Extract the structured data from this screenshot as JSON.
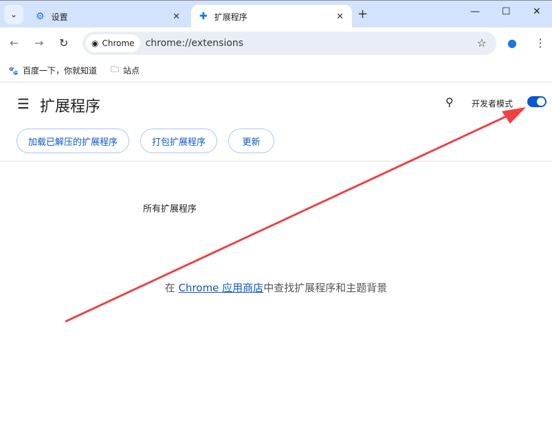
{
  "tabs": [
    {
      "label": "设置",
      "icon": "gear-icon"
    },
    {
      "label": "扩展程序",
      "icon": "puzzle-icon"
    }
  ],
  "omnibox": {
    "chip": "Chrome",
    "url": "chrome://extensions"
  },
  "bookmarks": [
    {
      "label": "百度一下，你就知道",
      "icon": "baidu-icon"
    },
    {
      "label": "站点",
      "icon": "folder-icon"
    }
  ],
  "header": {
    "title": "扩展程序",
    "dev_mode_label": "开发者模式",
    "dev_mode_on": true
  },
  "buttons": {
    "load": "加载已解压的扩展程序",
    "pack": "打包扩展程序",
    "update": "更新"
  },
  "main": {
    "section": "所有扩展程序",
    "store_prefix": "在 ",
    "store_link": "Chrome 应用商店",
    "store_suffix": "中查找扩展程序和主题背景"
  },
  "colors": {
    "accent": "#0b57d0",
    "arrow": "#f04040"
  }
}
